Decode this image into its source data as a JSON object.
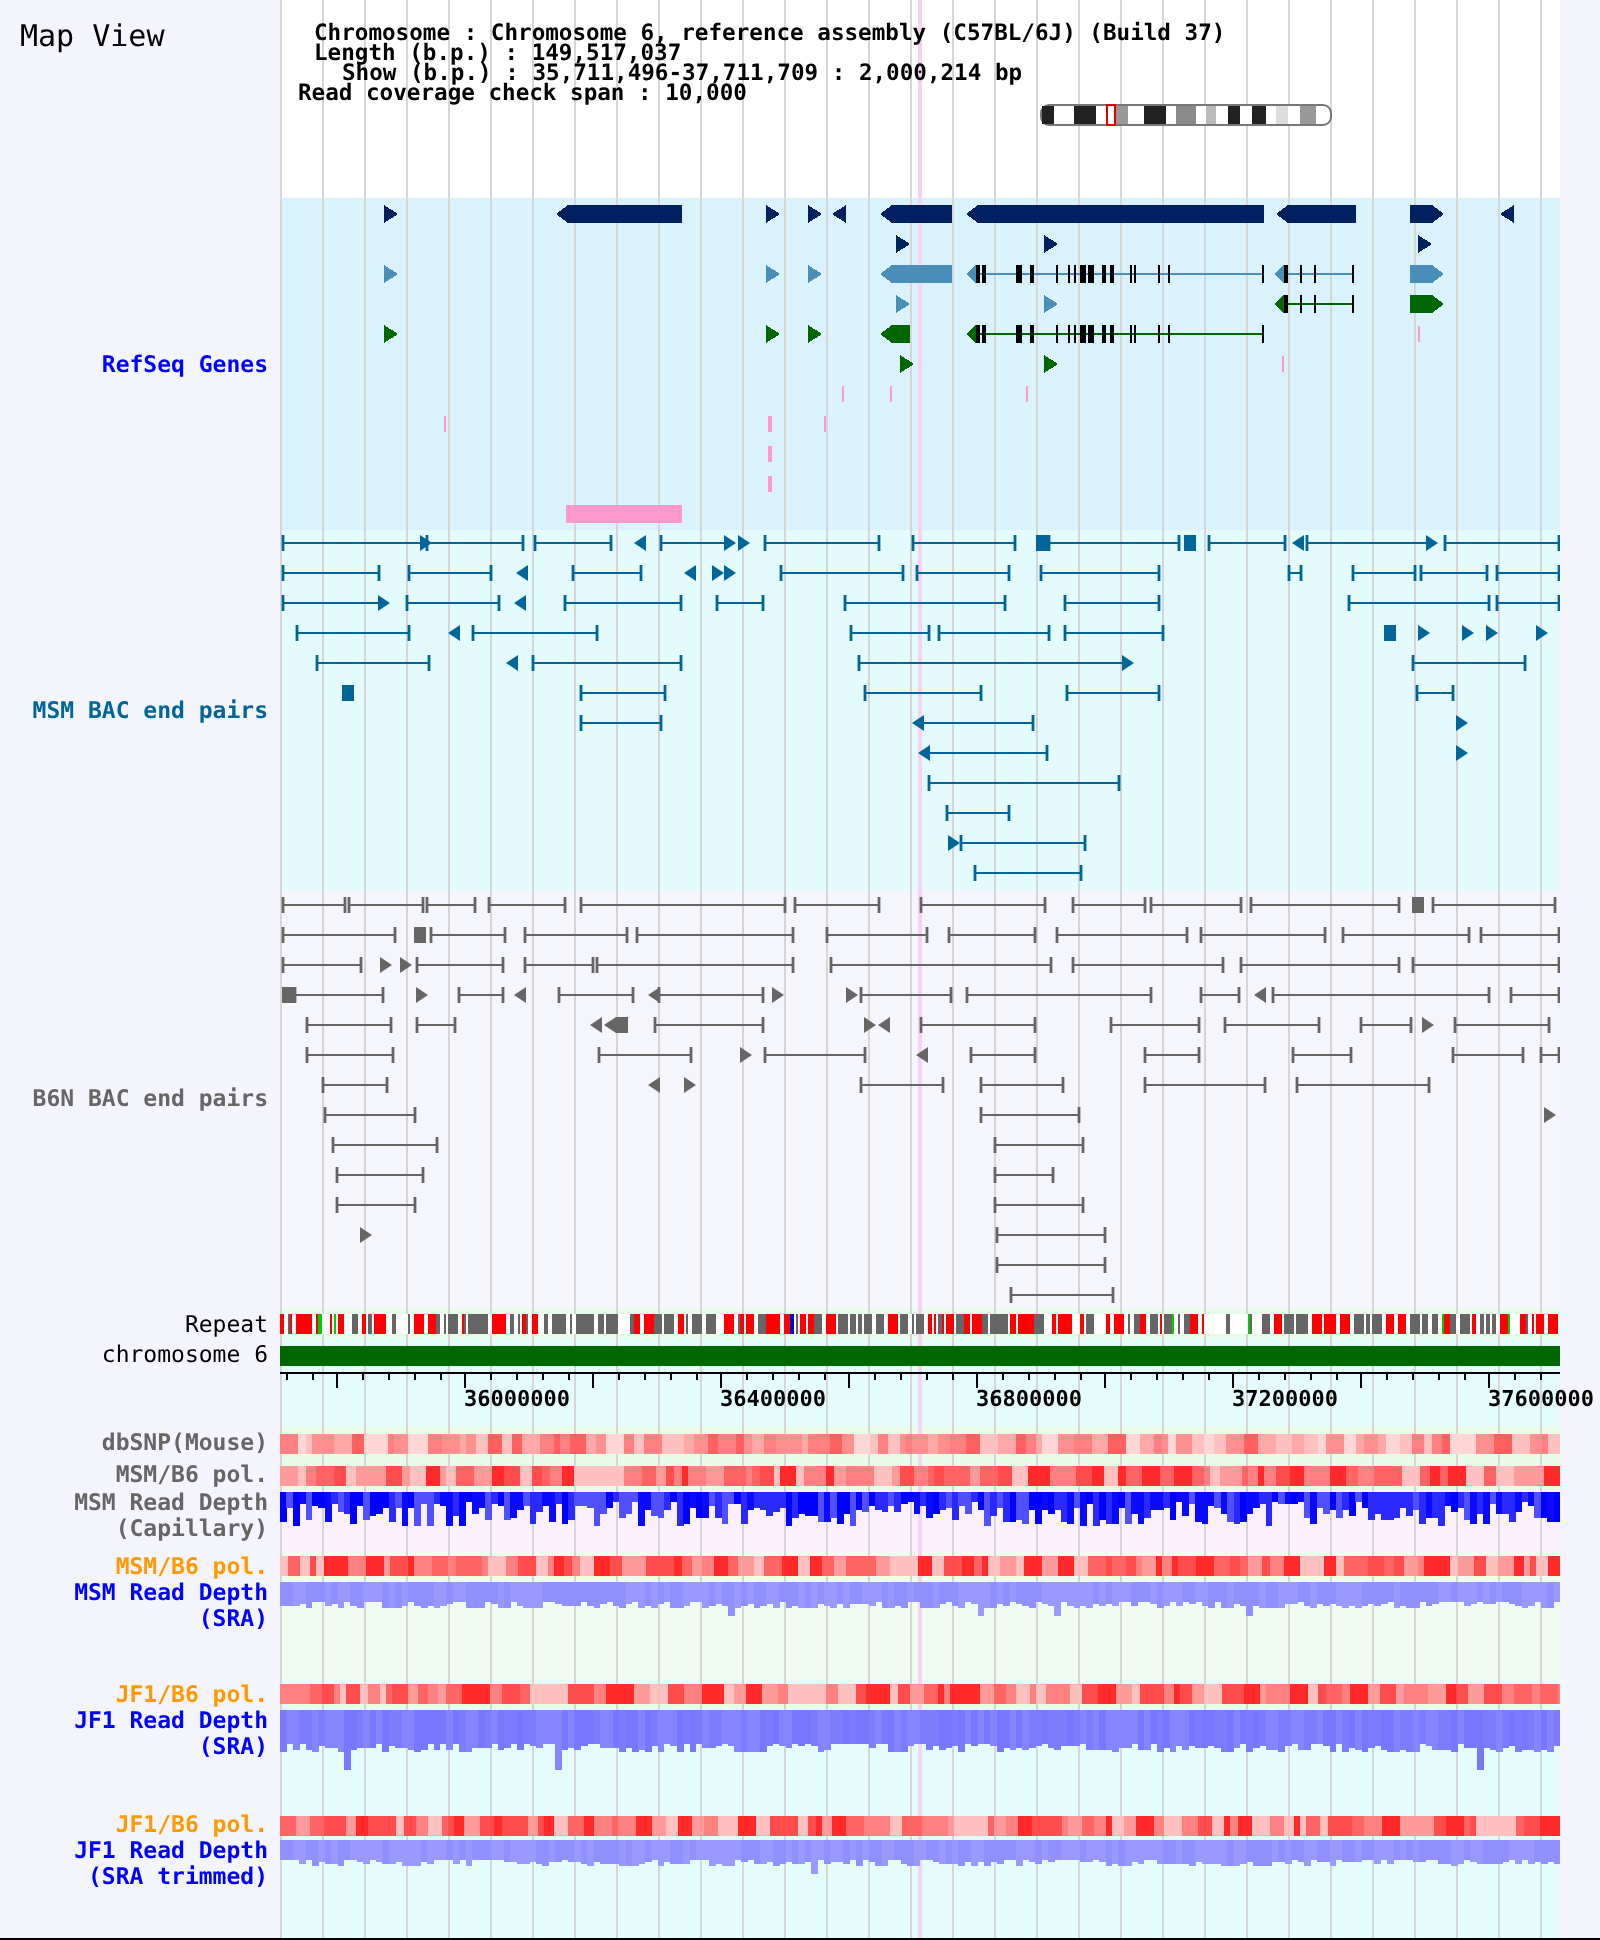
{
  "view": {
    "title": "Map View"
  },
  "info": [
    "Chromosome : Chromosome 6, reference assembly (C57BL/6J) (Build 37)",
    "Length (b.p.) : 149,517,037",
    "Show (b.p.) : 35,711,496-37,711,709 : 2,000,214 bp",
    "Read coverage check span : 10,000"
  ],
  "tracks": [
    {
      "kind": "genes",
      "label": "RefSeq Genes",
      "color": "#0000ff"
    },
    {
      "kind": "bac_pairs",
      "label": "MSM BAC end pairs",
      "color": "#006699"
    },
    {
      "kind": "bac_pairs",
      "label": "B6N BAC end pairs",
      "color": "#666666"
    },
    {
      "kind": "repeat",
      "label": "Repeat",
      "color": "#000000"
    },
    {
      "kind": "chromosome",
      "label": "chromosome 6",
      "color": "#000000"
    },
    {
      "kind": "ruler",
      "tick_labels": [
        "36000000",
        "36400000",
        "36800000",
        "37200000",
        "37600000"
      ]
    },
    {
      "kind": "heat",
      "label": "dbSNP(Mouse)",
      "color": "#666666"
    },
    {
      "kind": "heat",
      "label": "MSM/B6 pol.",
      "color": "#666666"
    },
    {
      "kind": "depth",
      "label": "MSM Read Depth (Capillary)",
      "color": "#666666"
    },
    {
      "kind": "heat",
      "label": "MSM/B6 pol.",
      "color": "#ff9900"
    },
    {
      "kind": "depth",
      "label": "MSM Read Depth (SRA)",
      "color": "#0000ff"
    },
    {
      "kind": "heat",
      "label": "JF1/B6 pol.",
      "color": "#ff9900"
    },
    {
      "kind": "depth",
      "label": "JF1 Read Depth (SRA)",
      "color": "#0000ff"
    },
    {
      "kind": "heat",
      "label": "JF1/B6 pol.",
      "color": "#ff9900"
    },
    {
      "kind": "depth",
      "label": "JF1 Read Depth (SRA trimmed)",
      "color": "#0000ff"
    }
  ]
}
